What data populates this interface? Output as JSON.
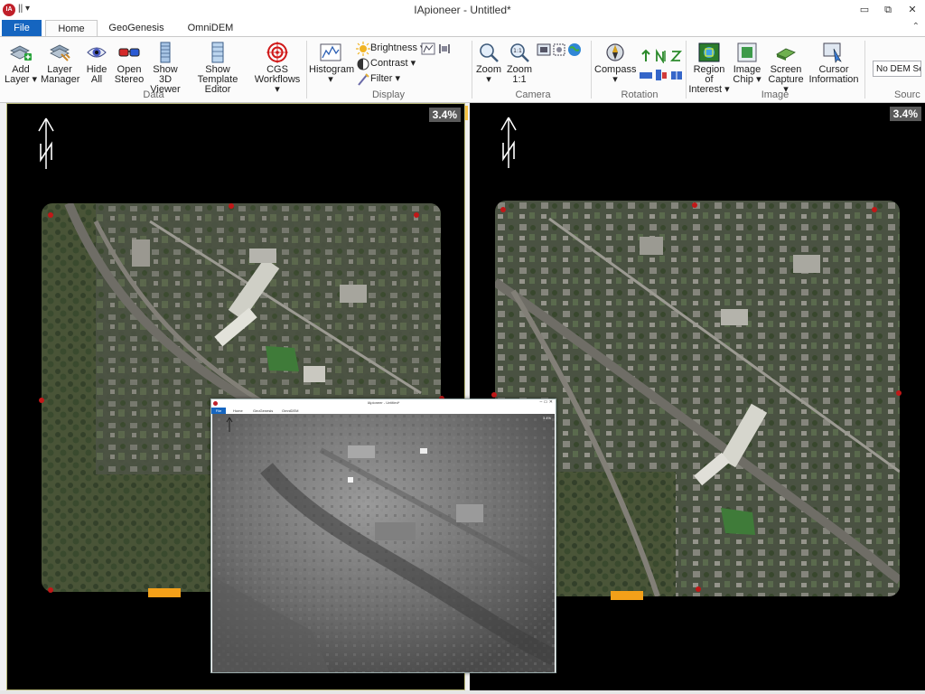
{
  "window": {
    "title": "IApioneer - Untitled*",
    "logo_text": "IA",
    "qat_symbols": "|| ▾",
    "controls": {
      "minimize": "▭",
      "restore": "⧉",
      "close": "✕"
    },
    "ribbon_collapse": "⌃"
  },
  "tabs": [
    {
      "label": "File"
    },
    {
      "label": "Home"
    },
    {
      "label": "GeoGenesis"
    },
    {
      "label": "OmniDEM"
    }
  ],
  "ribbon": {
    "data_group": {
      "label": "Data",
      "buttons": {
        "add_layer": {
          "line1": "Add",
          "line2": "Layer ▾"
        },
        "layer_manager": {
          "line1": "Layer",
          "line2": "Manager"
        },
        "hide_all": {
          "line1": "Hide",
          "line2": "All"
        },
        "open_stereo": {
          "line1": "Open",
          "line2": "Stereo"
        },
        "show_3d": {
          "line1": "Show 3D",
          "line2": "Viewer"
        },
        "show_template": {
          "line1": "Show Template",
          "line2": "Editor"
        },
        "cgs": {
          "line1": "CGS",
          "line2": "Workflows ▾"
        }
      }
    },
    "display_group": {
      "label": "Display",
      "histogram": {
        "line1": "Histogram",
        "line2": "▾"
      },
      "brightness": "Brightness ▾",
      "contrast": "Contrast ▾",
      "filter": "Filter ▾",
      "percent_symbol": "%"
    },
    "camera_group": {
      "label": "Camera",
      "zoom": {
        "line1": "Zoom",
        "line2": "▾"
      },
      "zoom_1_1": {
        "line1": "Zoom",
        "line2": "1:1"
      }
    },
    "rotation_group": {
      "label": "Rotation",
      "compass": {
        "line1": "Compass",
        "line2": "▾"
      }
    },
    "image_group": {
      "label": "Image",
      "region": {
        "line1": "Region of",
        "line2": "Interest ▾"
      },
      "chip": {
        "line1": "Image",
        "line2": "Chip ▾"
      },
      "capture": {
        "line1": "Screen",
        "line2": "Capture ▾"
      },
      "cursor": {
        "line1": "Cursor",
        "line2": "Information"
      }
    },
    "source_group": {
      "label": "Sourc",
      "dem_value": "No DEM Se"
    }
  },
  "viewports": {
    "left": {
      "zoom": "3.4%"
    },
    "right": {
      "zoom": "3.4%"
    }
  },
  "dem_window": {
    "title": "IApioneer - Untitled*",
    "tabs": [
      "Home",
      "GeoGenesis",
      "OmniDEM"
    ],
    "file_tab": "File",
    "zoom": "3.4%",
    "controls": "–  ▭  ✕"
  },
  "colors": {
    "accent": "#1565c0",
    "fiducial_text": "#39e63a",
    "label_plate": "#f3a019",
    "viewport_bg": "#000000"
  }
}
